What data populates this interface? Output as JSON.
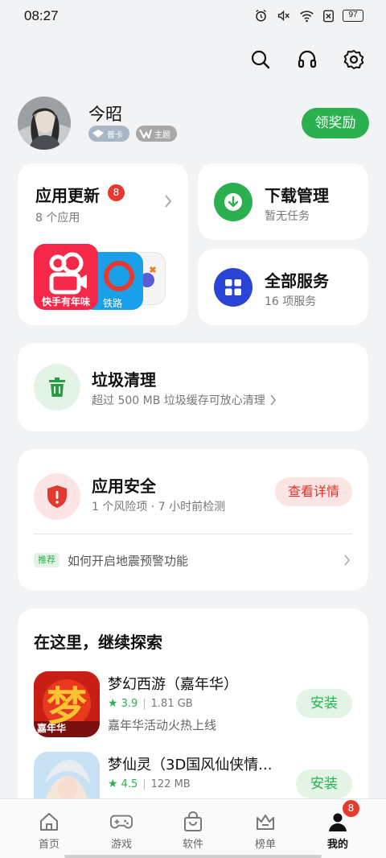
{
  "status_bar": {
    "time": "08:27",
    "battery": "97",
    "icons": [
      "alarm-icon",
      "mute-icon",
      "wifi-icon",
      "sim-off-icon",
      "battery-icon"
    ]
  },
  "top_actions": [
    "search-icon",
    "headset-icon",
    "gear-icon"
  ],
  "profile": {
    "name": "今昭",
    "badge_1": "普卡",
    "badge_2": "主题",
    "reward_button": "领奖励"
  },
  "app_update": {
    "title": "应用更新",
    "count": "8",
    "subtitle": "8 个应用",
    "app_banner_text": "快手有年味",
    "app_2_text": "铁路"
  },
  "download": {
    "title": "下载管理",
    "subtitle": "暂无任务",
    "color": "#2bb050"
  },
  "services": {
    "title": "全部服务",
    "subtitle": "16 项服务",
    "color": "#2a44d6"
  },
  "cleanup": {
    "title": "垃圾清理",
    "subtitle": "超过 500 MB 垃圾缓存可放心清理",
    "color": "#2bb050"
  },
  "security": {
    "title": "应用安全",
    "subtitle": "1 个风险项 · 7 小时前检测",
    "detail_button": "查看详情",
    "tip_tag": "推荐",
    "tip_text": "如何开启地震预警功能",
    "color": "#e03a30"
  },
  "explore": {
    "title": "在这里，继续探索",
    "games": [
      {
        "name": "梦幻西游（嘉年华）",
        "rating": "3.9",
        "size": "1.81 GB",
        "desc": "嘉年华活动火热上线",
        "install": "安装",
        "icon_text": "梦",
        "icon_sub": "嘉年华"
      },
      {
        "name": "梦仙灵（3D国风仙侠情...",
        "rating": "4.5",
        "size": "122 MB",
        "desc": "",
        "install": "安装"
      }
    ]
  },
  "bottom_nav": {
    "items": [
      {
        "label": "首页",
        "icon": "home-icon"
      },
      {
        "label": "游戏",
        "icon": "gamepad-icon"
      },
      {
        "label": "软件",
        "icon": "bag-icon"
      },
      {
        "label": "榜单",
        "icon": "crown-icon"
      },
      {
        "label": "我的",
        "icon": "person-icon"
      }
    ],
    "badge": "8",
    "active_index": 4
  }
}
